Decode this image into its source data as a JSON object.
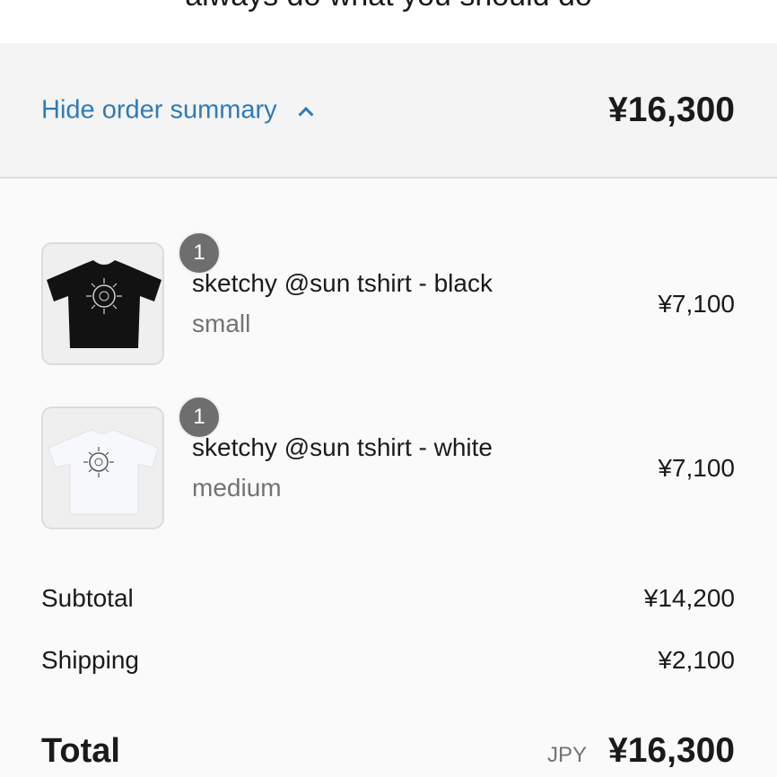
{
  "banner": {
    "text": "always do what you should do"
  },
  "summary_toggle": {
    "label": "Hide order summary",
    "total": "¥16,300"
  },
  "items": [
    {
      "name": "sketchy @sun tshirt - black",
      "variant": "small",
      "price": "¥7,100",
      "quantity": "1",
      "shirt_color": "#121212"
    },
    {
      "name": "sketchy @sun tshirt - white",
      "variant": "medium",
      "price": "¥7,100",
      "quantity": "1",
      "shirt_color": "#f7f8fb"
    }
  ],
  "totals": {
    "subtotal_label": "Subtotal",
    "subtotal_value": "¥14,200",
    "shipping_label": "Shipping",
    "shipping_value": "¥2,100",
    "total_label": "Total",
    "currency": "JPY",
    "total_value": "¥16,300"
  },
  "colors": {
    "link": "#2f7bb6",
    "badge": "#6e6e6e",
    "muted": "#737373"
  }
}
